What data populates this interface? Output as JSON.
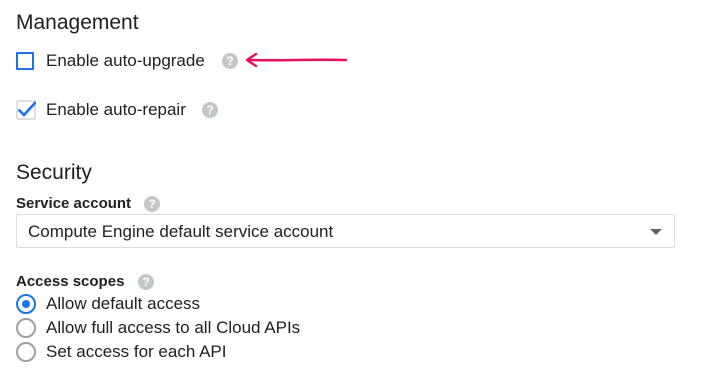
{
  "management": {
    "heading": "Management",
    "auto_upgrade": {
      "label": "Enable auto-upgrade",
      "checked": false,
      "help_icon": "help-icon"
    },
    "auto_repair": {
      "label": "Enable auto-repair",
      "checked": true,
      "help_icon": "help-icon"
    },
    "annotation": {
      "icon": "arrow-left-annotation",
      "color": "#e6105f"
    }
  },
  "security": {
    "heading": "Security",
    "service_account": {
      "label": "Service account",
      "value": "Compute Engine default service account"
    },
    "access_scopes": {
      "label": "Access scopes",
      "options": [
        {
          "label": "Allow default access",
          "selected": true
        },
        {
          "label": "Allow full access to all Cloud APIs",
          "selected": false
        },
        {
          "label": "Set access for each API",
          "selected": false
        }
      ]
    }
  },
  "colors": {
    "accent": "#1a73e8",
    "text": "#202124",
    "help_icon": "#c4c7ca",
    "annotation": "#e6105f"
  }
}
